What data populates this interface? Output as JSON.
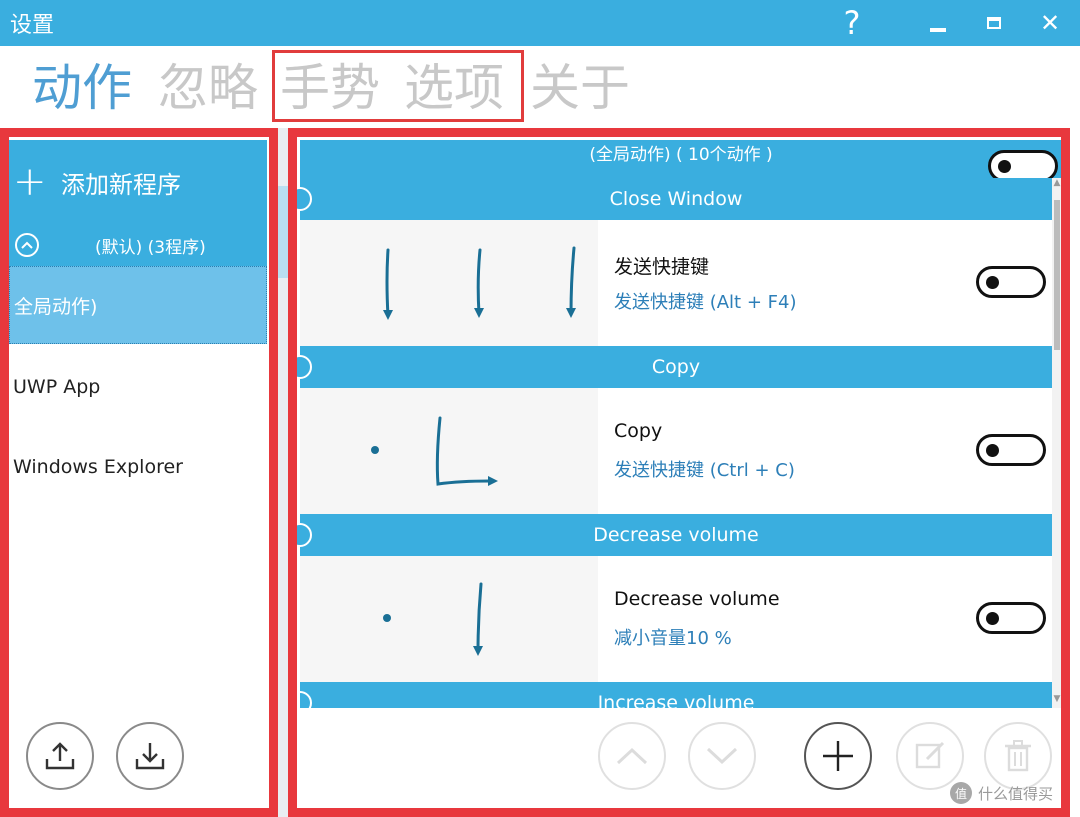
{
  "window": {
    "title": "设置",
    "help_glyph": "?",
    "close_glyph": "✕"
  },
  "nav": {
    "tabs": [
      {
        "label": "动作",
        "active": true
      },
      {
        "label": "忽略"
      },
      {
        "label": "手势"
      },
      {
        "label": "选项"
      },
      {
        "label": "关于"
      }
    ]
  },
  "sidebar": {
    "add_program_label": "添加新程序",
    "group_label": "(默认) (3程序)",
    "items": [
      {
        "label": "全局动作)",
        "selected": true
      },
      {
        "label": "UWP App"
      },
      {
        "label": "Windows Explorer"
      }
    ]
  },
  "panel": {
    "global_header": "(全局动作)  ( 10个动作 )",
    "actions": [
      {
        "header": "Close Window",
        "name": "发送快捷键",
        "description": "发送快捷键 (Alt + F4)",
        "enabled": false
      },
      {
        "header": "Copy",
        "name": "Copy",
        "description": "发送快捷键 (Ctrl + C)",
        "enabled": false
      },
      {
        "header": "Decrease volume",
        "name": "Decrease volume",
        "description": "减小音量10 %",
        "enabled": false
      },
      {
        "header": "Increase volume"
      }
    ]
  },
  "watermark": {
    "text": "什么值得买",
    "mark": "值"
  },
  "colors": {
    "accent": "#3aaedf",
    "highlight_frame": "#e8383d",
    "active_tab": "#4f9ed3",
    "description_text": "#2d7fb8"
  }
}
